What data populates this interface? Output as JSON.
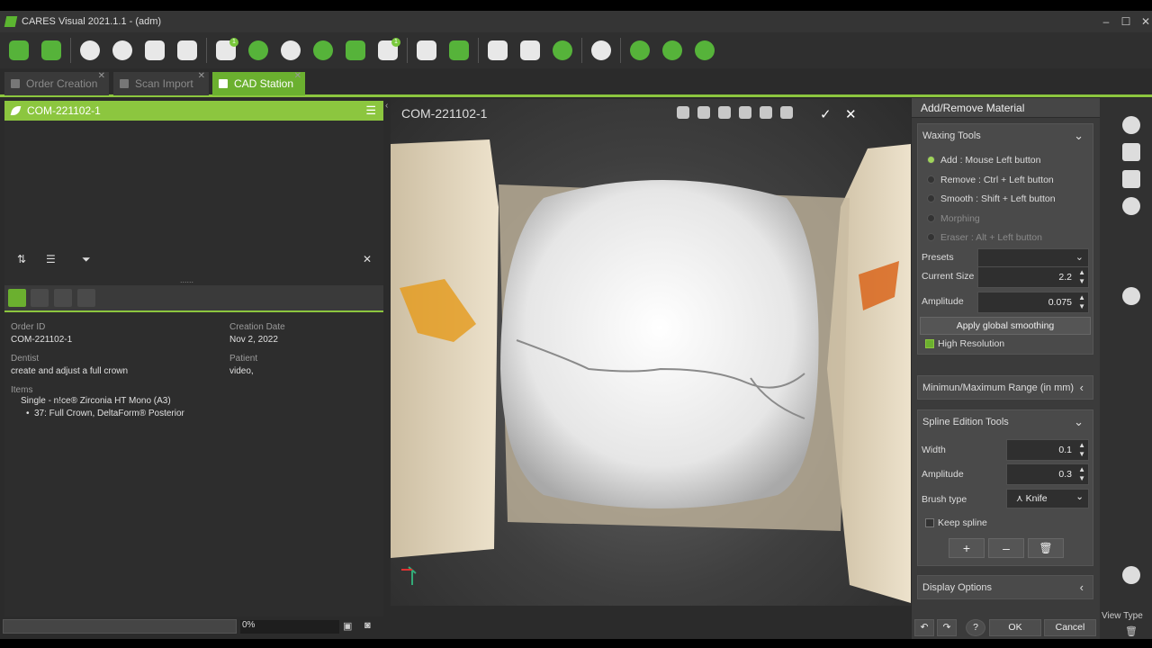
{
  "window": {
    "title": "CARES Visual 2021.1.1 - (adm)",
    "minimize": "–",
    "maximize": "☐",
    "close": "✕"
  },
  "toolbar": {
    "badges": {
      "one": "1",
      "two": "1"
    }
  },
  "tabs": [
    {
      "label": "Order Creation",
      "close": "✕"
    },
    {
      "label": "Scan Import",
      "close": "✕"
    },
    {
      "label": "CAD Station",
      "close": "✕"
    }
  ],
  "left_panel": {
    "case_id": "COM-221102-1",
    "menu_icon": "☰",
    "filter_icon": "⏷",
    "close_icon": "✕",
    "handle": "......",
    "order_id_label": "Order ID",
    "order_id": "COM-221102-1",
    "creation_date_label": "Creation Date",
    "creation_date": "Nov 2, 2022",
    "dentist_label": "Dentist",
    "dentist": "create and adjust a full crown",
    "patient_label": "Patient",
    "patient": "video,",
    "items_label": "Items",
    "item_group": "Single - n!ce® Zirconia HT Mono (A3)",
    "item_detail": "37: Full Crown, DeltaForm® Posterior",
    "progress_text": "0%"
  },
  "viewport": {
    "title": "COM-221102-1",
    "accept": "✓",
    "cancel": "✕"
  },
  "right_panel": {
    "title": "Add/Remove Material",
    "waxing_tools": "Waxing Tools",
    "options": {
      "add": "Add : Mouse Left button",
      "remove": "Remove : Ctrl + Left button",
      "smooth": "Smooth : Shift + Left button",
      "morphing": "Morphing",
      "eraser": "Eraser : Alt + Left button"
    },
    "presets_label": "Presets",
    "current_size_label": "Current Size",
    "current_size": "2.2",
    "amplitude_label": "Amplitude",
    "amplitude": "0.075",
    "apply_smoothing": "Apply global smoothing",
    "high_resolution": "High Resolution",
    "min_max_range": "Minimun/Maximum Range (in mm)",
    "spline_tools": "Spline Edition Tools",
    "width_label": "Width",
    "width": "0.1",
    "spline_amplitude_label": "Amplitude",
    "spline_amplitude": "0.3",
    "brush_type_label": "Brush type",
    "brush_type": "Knife",
    "keep_spline": "Keep spline",
    "plus": "+",
    "minus": "–",
    "display_options": "Display Options",
    "ok": "OK",
    "cancel": "Cancel",
    "help": "?"
  },
  "right_strip": {
    "view_type": "View Type"
  },
  "colors": {
    "accent": "#8cc63f",
    "accent_dark": "#6bb02f"
  }
}
